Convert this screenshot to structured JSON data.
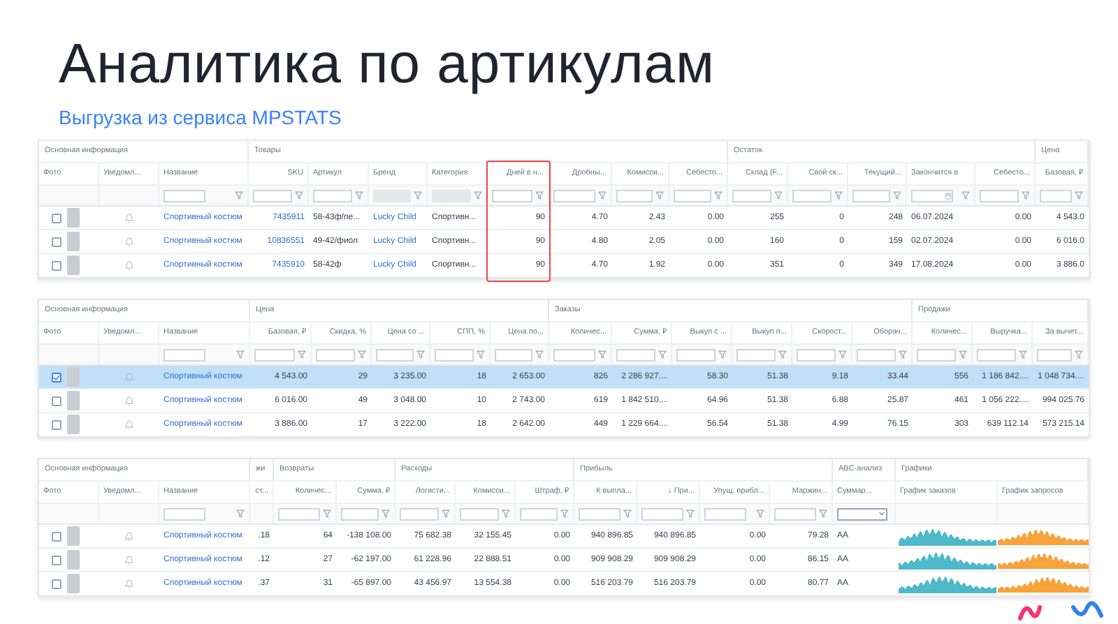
{
  "title": "Аналитика по артикулам",
  "subtitle": "Выгрузка из сервиса MPSTATS",
  "tables": [
    {
      "groups": [
        {
          "label": "Основная информация",
          "columns": [
            {
              "label": "Фото",
              "kind": "photo",
              "highlighted": false
            },
            {
              "label": "Уведомл...",
              "kind": "bell",
              "highlighted": false
            },
            {
              "label": "Название",
              "kind": "link",
              "filter": {
                "kind": "text"
              },
              "highlighted": false
            }
          ]
        },
        {
          "label": "Товары",
          "columns": [
            {
              "label": "SKU",
              "kind": "linknum",
              "filter": {
                "kind": "text"
              },
              "highlighted": false
            },
            {
              "label": "Артикул",
              "kind": "text",
              "filter": {
                "kind": "text"
              },
              "highlighted": false
            },
            {
              "label": "Бренд",
              "kind": "link",
              "filter": {
                "kind": "select"
              },
              "highlighted": false
            },
            {
              "label": "Категория",
              "kind": "text",
              "filter": {
                "kind": "select"
              },
              "highlighted": false
            },
            {
              "label": "Дней в н...",
              "kind": "number",
              "filter": {
                "kind": "text"
              },
              "highlighted": true
            },
            {
              "label": "Дробны...",
              "kind": "number",
              "filter": {
                "kind": "text"
              },
              "highlighted": false
            },
            {
              "label": "Комисси...",
              "kind": "number",
              "filter": {
                "kind": "text"
              },
              "highlighted": false
            },
            {
              "label": "Себесто...",
              "kind": "number",
              "filter": {
                "kind": "text"
              },
              "highlighted": false
            }
          ]
        },
        {
          "label": "Остаток",
          "columns": [
            {
              "label": "Склад (F...",
              "kind": "number",
              "filter": {
                "kind": "text"
              },
              "highlighted": false
            },
            {
              "label": "Свой ск...",
              "kind": "number",
              "filter": {
                "kind": "text"
              },
              "highlighted": false
            },
            {
              "label": "Текущий...",
              "kind": "number",
              "filter": {
                "kind": "text"
              },
              "highlighted": false
            },
            {
              "label": "Закончится в",
              "kind": "text",
              "filter": {
                "kind": "date"
              },
              "highlighted": false
            },
            {
              "label": "Себесто...",
              "kind": "number",
              "filter": {
                "kind": "text"
              },
              "highlighted": false
            }
          ]
        },
        {
          "label": "Цена",
          "columns": [
            {
              "label": "Базовая, ₽",
              "kind": "number",
              "filter": {
                "kind": "text"
              },
              "highlighted": false
            }
          ]
        }
      ],
      "rows": [
        {
          "checked": false,
          "selected": false,
          "cells": [
            "Спортивный костюм",
            "7435911",
            "58-43ф/пе...",
            "Lucky Child",
            "Спортивн...",
            "90",
            "4.70",
            "2.43",
            "0.00",
            "255",
            "0",
            "248",
            "06.07.2024",
            "0.00",
            "4 543.0"
          ]
        },
        {
          "checked": false,
          "selected": false,
          "cells": [
            "Спортивный костюм",
            "10836551",
            "49-42/фиол",
            "Lucky Child",
            "Спортивн...",
            "90",
            "4.80",
            "2.05",
            "0.00",
            "160",
            "0",
            "159",
            "02.07.2024",
            "0.00",
            "6 016.0"
          ]
        },
        {
          "checked": false,
          "selected": false,
          "cells": [
            "Спортивный костюм",
            "7435910",
            "58-42ф",
            "Lucky Child",
            "Спортивн...",
            "90",
            "4.70",
            "1.92",
            "0.00",
            "351",
            "0",
            "349",
            "17.08.2024",
            "0.00",
            "3 886.0"
          ]
        }
      ]
    },
    {
      "groups": [
        {
          "label": "Основная информация",
          "columns": [
            {
              "label": "Фото",
              "kind": "photo"
            },
            {
              "label": "Уведомл...",
              "kind": "bell"
            },
            {
              "label": "Название",
              "kind": "link",
              "filter": {
                "kind": "text"
              }
            }
          ]
        },
        {
          "label": "Цена",
          "columns": [
            {
              "label": "Базовая, ₽",
              "kind": "number",
              "filter": {
                "kind": "text"
              }
            },
            {
              "label": "Скидка, %",
              "kind": "number",
              "filter": {
                "kind": "text"
              }
            },
            {
              "label": "Цена со ...",
              "kind": "number",
              "filter": {
                "kind": "text"
              }
            },
            {
              "label": "СПП, %",
              "kind": "number",
              "filter": {
                "kind": "text"
              }
            },
            {
              "label": "Цена по...",
              "kind": "number",
              "filter": {
                "kind": "text"
              }
            }
          ]
        },
        {
          "label": "Заказы",
          "columns": [
            {
              "label": "Количес...",
              "kind": "number",
              "filter": {
                "kind": "text"
              }
            },
            {
              "label": "Сумма, ₽",
              "kind": "number",
              "filter": {
                "kind": "text"
              }
            },
            {
              "label": "Выкуп с ...",
              "kind": "number",
              "filter": {
                "kind": "text"
              }
            },
            {
              "label": "Выкуп п...",
              "kind": "number",
              "filter": {
                "kind": "text"
              }
            },
            {
              "label": "Скорост...",
              "kind": "number",
              "filter": {
                "kind": "text"
              }
            },
            {
              "label": "Оборач...",
              "kind": "number",
              "filter": {
                "kind": "text"
              }
            }
          ]
        },
        {
          "label": "Продажи",
          "columns": [
            {
              "label": "Количес...",
              "kind": "number",
              "filter": {
                "kind": "text"
              }
            },
            {
              "label": "Выручка...",
              "kind": "number",
              "filter": {
                "kind": "text"
              }
            },
            {
              "label": "За вычет...",
              "kind": "number",
              "filter": {
                "kind": "text"
              }
            }
          ]
        }
      ],
      "rows": [
        {
          "checked": true,
          "selected": true,
          "cells": [
            "Спортивный костюм",
            "4 543.00",
            "29",
            "3 235.00",
            "18",
            "2 653.00",
            "826",
            "2 286 927....",
            "58.30",
            "51.38",
            "9.18",
            "33.44",
            "556",
            "1 186 842....",
            "1 048 734...."
          ]
        },
        {
          "checked": false,
          "selected": false,
          "cells": [
            "Спортивный костюм",
            "6 016.00",
            "49",
            "3 048.00",
            "10",
            "2 743.00",
            "619",
            "1 842 510....",
            "64.96",
            "51.38",
            "6.88",
            "25.87",
            "461",
            "1 056 222....",
            "994 025.76"
          ]
        },
        {
          "checked": false,
          "selected": false,
          "cells": [
            "Спортивный костюм",
            "3 886.00",
            "17",
            "3 222.00",
            "18",
            "2 642.00",
            "449",
            "1 229 664....",
            "56.54",
            "51.38",
            "4.99",
            "76.15",
            "303",
            "639 112.14",
            "573 215.14"
          ]
        }
      ]
    },
    {
      "groups": [
        {
          "label": "Основная информация",
          "columns": [
            {
              "label": "Фото",
              "kind": "photo"
            },
            {
              "label": "Уведомл...",
              "kind": "bell"
            },
            {
              "label": "Название",
              "kind": "link",
              "filter": {
                "kind": "text"
              }
            }
          ]
        },
        {
          "label": "жи",
          "columns": [
            {
              "label": "ст...",
              "kind": "number"
            }
          ]
        },
        {
          "label": "Возвраты",
          "columns": [
            {
              "label": "Количес...",
              "kind": "number",
              "filter": {
                "kind": "text"
              }
            },
            {
              "label": "Сумма, ₽",
              "kind": "number",
              "filter": {
                "kind": "text"
              }
            }
          ]
        },
        {
          "label": "Расходы",
          "columns": [
            {
              "label": "Логисти...",
              "kind": "number",
              "filter": {
                "kind": "text"
              }
            },
            {
              "label": "Комисси...",
              "kind": "number",
              "filter": {
                "kind": "text"
              }
            },
            {
              "label": "Штраф, ₽",
              "kind": "number",
              "filter": {
                "kind": "text"
              }
            }
          ]
        },
        {
          "label": "Прибыль",
          "columns": [
            {
              "label": "К выпла...",
              "kind": "number",
              "filter": {
                "kind": "text"
              }
            },
            {
              "label": "↓ При...",
              "kind": "number",
              "filter": {
                "kind": "text"
              }
            },
            {
              "label": "Упущ. прибл...",
              "kind": "number",
              "filter": {
                "kind": "text"
              }
            },
            {
              "label": "Маржин...",
              "kind": "number",
              "filter": {
                "kind": "text"
              }
            }
          ]
        },
        {
          "label": "ABC-анализ",
          "columns": [
            {
              "label": "Суммар...",
              "kind": "text",
              "filter": {
                "kind": "dropdown"
              }
            }
          ]
        },
        {
          "label": "Графики",
          "columns": [
            {
              "label": "График заказов",
              "kind": "spark",
              "color": "#4fb8c9"
            },
            {
              "label": "График запросов",
              "kind": "spark",
              "color": "#f7a23b"
            }
          ]
        }
      ],
      "rows": [
        {
          "checked": false,
          "selected": false,
          "cells": [
            "Спортивный костюм",
            ".18",
            "64",
            "-138 108.00",
            "75 682.38",
            "32 155.45",
            "0.00",
            "940 896.85",
            "940 896.85",
            "0.00",
            "79.28",
            "AA"
          ]
        },
        {
          "checked": false,
          "selected": false,
          "cells": [
            "Спортивный костюм",
            ".12",
            "27",
            "-62 197.00",
            "61 228.96",
            "22 888.51",
            "0.00",
            "909 908.29",
            "909 908.29",
            "0.00",
            "86.15",
            "AA"
          ]
        },
        {
          "checked": false,
          "selected": false,
          "cells": [
            "Спортивный костюм",
            ".37",
            "31",
            "-65 897.00",
            "43 456.97",
            "13 554.38",
            "0.00",
            "516 203.79",
            "516 203.79",
            "0.00",
            "80.77",
            "AA"
          ]
        }
      ]
    }
  ]
}
